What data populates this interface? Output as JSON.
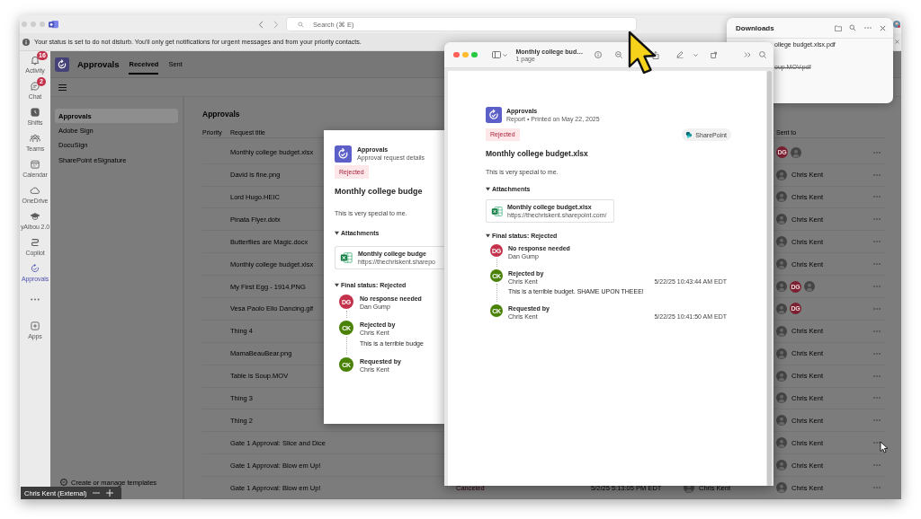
{
  "title_bar": {
    "search_placeholder": "Search (⌘ E)"
  },
  "notification": {
    "text": "Your status is set to do not disturb. You'll only get notifications for urgent messages and from your priority contacts."
  },
  "rail": {
    "items": [
      {
        "label": "Activity",
        "badge": "16",
        "selected": false
      },
      {
        "label": "Chat",
        "badge": "2",
        "selected": false
      },
      {
        "label": "Shifts",
        "selected": false
      },
      {
        "label": "Teams",
        "selected": false
      },
      {
        "label": "Calendar",
        "selected": false
      },
      {
        "label": "OneDrive",
        "selected": false
      },
      {
        "label": "yAibou 2.0",
        "selected": false
      },
      {
        "label": "Copilot",
        "selected": false
      },
      {
        "label": "Approvals",
        "selected": true
      }
    ],
    "apps_label": "Apps"
  },
  "app_header": {
    "title": "Approvals",
    "tabs": [
      {
        "label": "Received",
        "selected": true
      },
      {
        "label": "Sent",
        "selected": false
      }
    ]
  },
  "nav": {
    "items": [
      {
        "label": "Approvals",
        "selected": true
      },
      {
        "label": "Adobe Sign",
        "selected": false
      },
      {
        "label": "DocuSign",
        "selected": false
      },
      {
        "label": "SharePoint eSignature",
        "selected": false
      }
    ],
    "templates_link": "Create or manage templates"
  },
  "list": {
    "title": "Approvals",
    "columns": {
      "priority": "Priority",
      "title": "Request title",
      "sent_to": "Sent to"
    },
    "rows": [
      {
        "title": "Monthly college budget.xlsx",
        "recipients": [
          {
            "kind": "initials",
            "initials": "DG"
          },
          {
            "kind": "photo"
          }
        ]
      },
      {
        "title": "David is fine.png",
        "recipients": [
          {
            "kind": "photo"
          }
        ],
        "recipient_name": "Chris Kent"
      },
      {
        "title": "Lord Hugo.HEIC",
        "recipients": [
          {
            "kind": "photo"
          }
        ],
        "recipient_name": "Chris Kent"
      },
      {
        "title": "Pinata Flyer.dotx",
        "recipients": [
          {
            "kind": "photo"
          }
        ],
        "recipient_name": "Chris Kent"
      },
      {
        "title": "Butterflies are Magic.docx",
        "recipients": [
          {
            "kind": "photo"
          }
        ],
        "recipient_name": "Chris Kent"
      },
      {
        "title": "Monthly college budget.xlsx",
        "recipients": [
          {
            "kind": "photo"
          }
        ],
        "recipient_name": "Chris Kent"
      },
      {
        "title": "My First Egg - 1914.PNG",
        "recipients": [
          {
            "kind": "photo"
          },
          {
            "kind": "initials",
            "initials": "DG"
          },
          {
            "kind": "photo"
          }
        ]
      },
      {
        "title": "Vesa Paolo Elio Dancing.gif",
        "recipients": [
          {
            "kind": "photo"
          },
          {
            "kind": "initials",
            "initials": "DG"
          }
        ]
      },
      {
        "title": "Thing 4",
        "recipients": [
          {
            "kind": "photo"
          }
        ],
        "recipient_name": "Chris Kent"
      },
      {
        "title": "MamaBeauBear.png",
        "recipients": [
          {
            "kind": "photo"
          }
        ],
        "recipient_name": "Chris Kent"
      },
      {
        "title": "Table is Soup.MOV",
        "recipients": [
          {
            "kind": "photo"
          }
        ],
        "recipient_name": "Chris Kent"
      },
      {
        "title": "Thing 3",
        "recipients": [
          {
            "kind": "photo"
          }
        ],
        "recipient_name": "Chris Kent"
      },
      {
        "title": "Thing 2",
        "recipients": [
          {
            "kind": "photo"
          }
        ],
        "recipient_name": "Chris Kent"
      },
      {
        "title": "Gate 1 Approval: Slice and Dice",
        "recipients": [
          {
            "kind": "photo"
          }
        ],
        "recipient_name": "Chris Kent"
      },
      {
        "title": "Gate 1 Approval: Blow em Up!",
        "recipients": [
          {
            "kind": "photo"
          }
        ],
        "recipient_name": "Chris Kent"
      },
      {
        "title": "Gate 1 Approval: Blow em Up!",
        "status": "Canceled",
        "date": "5/2/25 5:13:05 PM EDT",
        "requester": "Chris Kent",
        "recipients": [
          {
            "kind": "photo"
          }
        ],
        "recipient_name": "Chris Kent"
      }
    ]
  },
  "details_card": {
    "app": "Approvals",
    "subtitle": "Approval request details",
    "status": "Rejected",
    "title": "Monthly college budge",
    "description": "This is very special to me.",
    "attachments": {
      "label": "Attachments",
      "expanded": true
    },
    "attachment": {
      "name": "Monthly college budge",
      "url": "https://thechriskent.sharepo"
    },
    "final_status": {
      "label": "Final status: Rejected",
      "expanded": true
    },
    "timeline": [
      {
        "initials": "DG",
        "color": "#c4314b",
        "label": "No response needed",
        "name": "Dan Gump"
      },
      {
        "initials": "CK",
        "color": "#498205",
        "label": "Rejected by",
        "name": "Chris Kent",
        "comment": "This is a terrible budge"
      },
      {
        "initials": "CK",
        "color": "#498205",
        "label": "Requested by",
        "name": "Chris Kent"
      }
    ]
  },
  "pdf_viewer": {
    "title": "Monthly college bud…",
    "subtitle": "1 page",
    "page": {
      "app": "Approvals",
      "meta": "Report • Printed on May 22, 2025",
      "status": "Rejected",
      "source": "SharePoint",
      "title": "Monthly college budget.xlsx",
      "description": "This is very special to me.",
      "attachments": {
        "label": "Attachments",
        "expanded": true
      },
      "attachment": {
        "name": "Monthly college budget.xlsx",
        "url": "https://thechriskent.sharepoint.com/"
      },
      "final_status": {
        "label": "Final status: Rejected",
        "expanded": true
      },
      "timeline": [
        {
          "initials": "DG",
          "color": "#c4314b",
          "label": "No response needed",
          "name": "Dan Gump"
        },
        {
          "initials": "CK",
          "color": "#498205",
          "label": "Rejected by",
          "name": "Chris Kent",
          "time": "5/22/25 10:43:44 AM EDT",
          "comment": "This is a terrible budget. SHAME UPON THEEE!"
        },
        {
          "initials": "CK",
          "color": "#498205",
          "label": "Requested by",
          "name": "Chris Kent",
          "time": "5/22/25 10:41:50 AM EDT"
        }
      ]
    }
  },
  "downloads": {
    "title": "Downloads",
    "items": [
      {
        "name": "ollege budget.xlsx.pdf",
        "removed": false
      },
      {
        "name": "oup.MOV.pdf",
        "removed": true
      }
    ]
  },
  "name_tag": {
    "label": "Chris Kent (External)"
  }
}
